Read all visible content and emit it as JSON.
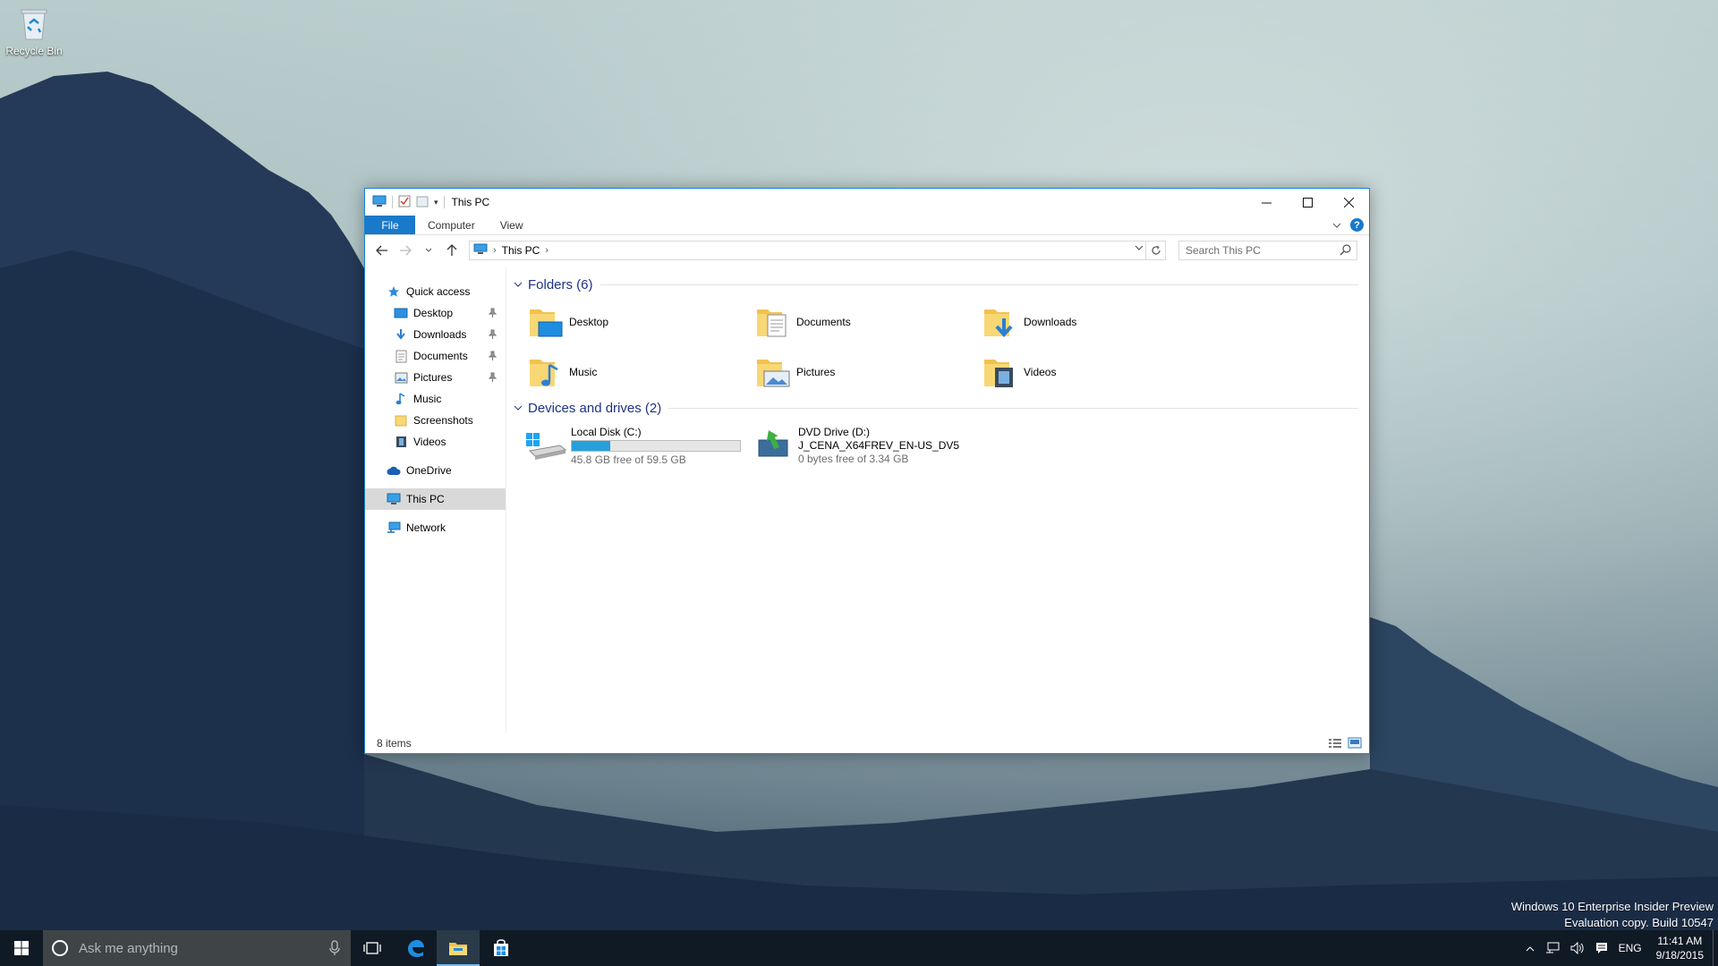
{
  "desktop": {
    "icons": [
      {
        "label": "Recycle Bin"
      }
    ],
    "watermark": {
      "line1": "Windows 10 Enterprise Insider Preview",
      "line2": "Evaluation copy. Build 10547"
    }
  },
  "window": {
    "title": "This PC",
    "controls": {
      "minimize": "—",
      "maximize": "☐",
      "close": "✕"
    },
    "ribbon_tabs": [
      {
        "label": "File"
      },
      {
        "label": "Computer"
      },
      {
        "label": "View"
      }
    ],
    "help_label": "?",
    "address": {
      "crumbs": [
        "This PC"
      ]
    },
    "search": {
      "placeholder": "Search This PC"
    },
    "sidebar": {
      "quick_access": "Quick access",
      "pinned": [
        {
          "label": "Desktop",
          "icon": "desktop-icon",
          "pinned": true
        },
        {
          "label": "Downloads",
          "icon": "downloads-icon",
          "pinned": true
        },
        {
          "label": "Documents",
          "icon": "documents-icon",
          "pinned": true
        },
        {
          "label": "Pictures",
          "icon": "pictures-icon",
          "pinned": true
        },
        {
          "label": "Music",
          "icon": "music-icon",
          "pinned": false
        },
        {
          "label": "Screenshots",
          "icon": "folder-icon",
          "pinned": false
        },
        {
          "label": "Videos",
          "icon": "videos-icon",
          "pinned": false
        }
      ],
      "onedrive": "OneDrive",
      "this_pc": "This PC",
      "network": "Network"
    },
    "groups": {
      "folders_header": "Folders (6)",
      "folders": [
        {
          "label": "Desktop"
        },
        {
          "label": "Documents"
        },
        {
          "label": "Downloads"
        },
        {
          "label": "Music"
        },
        {
          "label": "Pictures"
        },
        {
          "label": "Videos"
        }
      ],
      "drives_header": "Devices and drives (2)",
      "drives": [
        {
          "name": "Local Disk (C:)",
          "free_text": "45.8 GB free of 59.5 GB",
          "used_fraction": 0.23
        },
        {
          "name": "DVD Drive (D:)",
          "line2": "J_CENA_X64FREV_EN-US_DV5",
          "free_text": "0 bytes free of 3.34 GB"
        }
      ]
    },
    "status": {
      "items": "8 items"
    }
  },
  "taskbar": {
    "search_placeholder": "Ask me anything",
    "apps": [
      {
        "icon": "task-view-icon"
      },
      {
        "icon": "edge-icon"
      },
      {
        "icon": "file-explorer-icon",
        "active": true
      },
      {
        "icon": "store-icon"
      }
    ],
    "tray": {
      "language": "ENG",
      "time": "11:41 AM",
      "date": "9/18/2015"
    }
  },
  "colors": {
    "accent": "#1979ca",
    "group_header": "#1e3287",
    "drive_fill": "#26a0da",
    "taskbar": "#101a24"
  }
}
